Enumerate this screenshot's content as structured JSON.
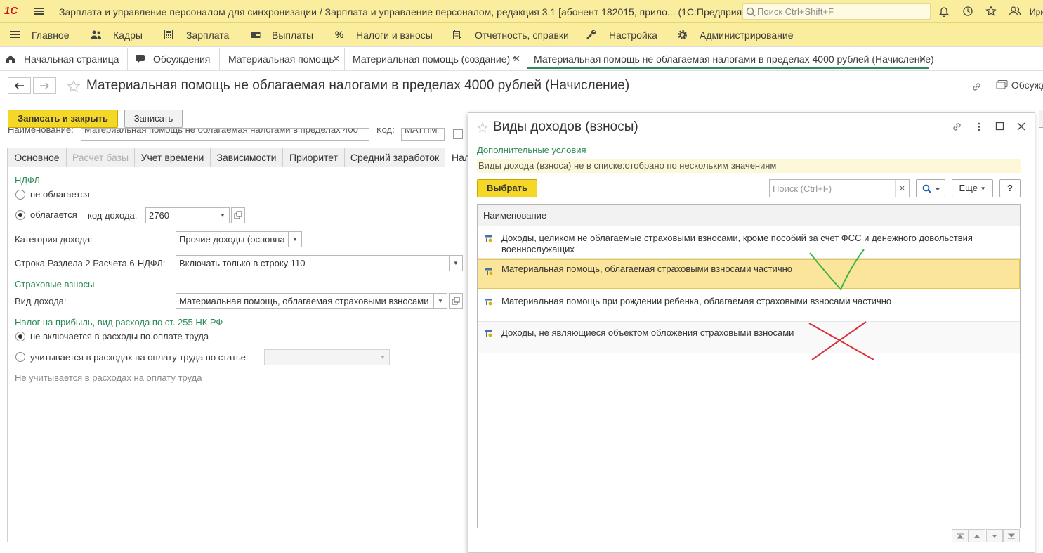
{
  "titlebar": {
    "logo": "1С",
    "title": "Зарплата и управление персоналом для синхронизации / Зарплата и управление персоналом, редакция 3.1 [абонент 182015, прило...  (1С:Предприятие)",
    "search_placeholder": "Поиск Ctrl+Shift+F",
    "user": "Ири"
  },
  "sections": [
    {
      "label": "Главное",
      "icon": "menu-icon"
    },
    {
      "label": "Кадры",
      "icon": "people-icon"
    },
    {
      "label": "Зарплата",
      "icon": "calculator-icon"
    },
    {
      "label": "Выплаты",
      "icon": "wallet-icon"
    },
    {
      "label": "Налоги и взносы",
      "icon": "percent-icon"
    },
    {
      "label": "Отчетность, справки",
      "icon": "reports-icon"
    },
    {
      "label": "Настройка",
      "icon": "wrench-icon"
    },
    {
      "label": "Администрирование",
      "icon": "gear-icon"
    }
  ],
  "tabs": [
    {
      "label": "Начальная страница"
    },
    {
      "label": "Обсуждения"
    },
    {
      "label": "Материальная помощь"
    },
    {
      "label": "Материальная помощь (создание) *"
    },
    {
      "label": "Материальная помощь не облагаемая налогами в пределах 4000 рублей (Начисление)"
    }
  ],
  "form": {
    "title": "Материальная помощь не облагаемая налогами в пределах 4000 рублей (Начисление)",
    "discuss": "Обсужд",
    "save_close": "Записать и закрыть",
    "save": "Записать",
    "name_label": "Наименование:",
    "name_value": "Материальная помощь не облагаемая налогами в пределах 400",
    "code_label": "Код:",
    "code_value": "МАТПМ",
    "form_tabs": [
      "Основное",
      "Расчет базы",
      "Учет времени",
      "Зависимости",
      "Приоритет",
      "Средний заработок",
      "Нал"
    ],
    "ndfl_header": "НДФЛ",
    "not_taxed": "не облагается",
    "taxed": "облагается",
    "income_code_label": "код дохода:",
    "income_code": "2760",
    "category_label": "Категория дохода:",
    "category_value": "Прочие доходы (основна",
    "line_label": "Строка Раздела 2 Расчета 6-НДФЛ:",
    "line_value": "Включать только в строку 110",
    "insurance_header": "Страховые взносы",
    "income_type_label": "Вид дохода:",
    "income_type_value": "Материальная помощь, облагаемая страховыми взносами",
    "profit_header": "Налог на прибыль, вид расхода по ст. 255 НК РФ",
    "not_included": "не включается в расходы по оплате труда",
    "included": "учитывается в расходах на оплату труда по статье:",
    "not_counted_note": "Не учитывается в расходах на оплату труда"
  },
  "dialog": {
    "title": "Виды доходов (взносы)",
    "conditions": "Дополнительные условия",
    "filter": "Виды дохода (взноса) не в списке:отобрано по нескольким значениям",
    "select_button": "Выбрать",
    "search_placeholder": "Поиск (Ctrl+F)",
    "clear": "×",
    "more": "Еще",
    "help": "?",
    "column": "Наименование",
    "rows": [
      {
        "text": "Доходы, целиком не облагаемые страховыми взносами, кроме пособий за счет ФСС и денежного довольствия военнослужащих",
        "selected": false
      },
      {
        "text": "Материальная помощь, облагаемая страховыми взносами частично",
        "selected": true
      },
      {
        "text": "Материальная помощь при рождении ребенка, облагаемая страховыми взносами частично",
        "selected": false
      },
      {
        "text": "Доходы, не являющиеся объектом обложения страховыми взносами",
        "selected": false
      }
    ]
  },
  "colors": {
    "accent_yellow": "#fbed9e",
    "button_yellow": "#f5d728",
    "green_text": "#2e8b57",
    "selected_row": "#fbe59a",
    "check_mark": "#3cb44b",
    "cross_mark": "#d9303a"
  }
}
